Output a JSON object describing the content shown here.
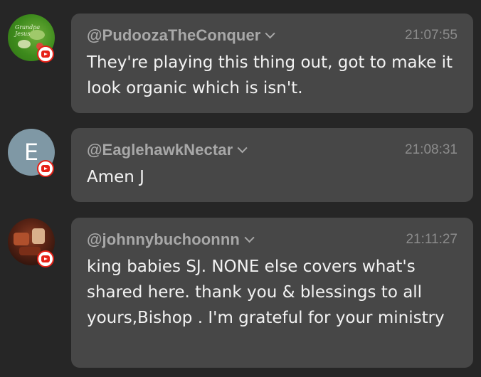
{
  "messages": [
    {
      "author": "@PudoozaTheConquer",
      "time": "21:07:55",
      "text": "They're playing this thing out, got to make it look organic which is isn't.",
      "avatar": {
        "type": "image",
        "description_icon": "green-channel-logo",
        "logo_text": "Grandpa Jesus"
      },
      "platform_icon": "youtube-icon"
    },
    {
      "author": "@EaglehawkNectar",
      "time": "21:08:31",
      "text": "Amen J",
      "avatar": {
        "type": "letter",
        "letter": "E",
        "color": "#7f98a5"
      },
      "platform_icon": "youtube-icon"
    },
    {
      "author": "@johnnybuchoonnn",
      "time": "21:11:27",
      "text": "king babies SJ. NONE else covers what's shared here. thank you & blessings to all yours,Bishop . I'm grateful for your ministry",
      "avatar": {
        "type": "image",
        "description_icon": "photo-avatar"
      },
      "platform_icon": "youtube-icon"
    }
  ],
  "colors": {
    "background": "#262626",
    "bubble": "#474747",
    "author": "#a8a8a8",
    "time": "#8c8c8c",
    "text": "#f2f2f2",
    "youtube_red": "#e62117"
  }
}
